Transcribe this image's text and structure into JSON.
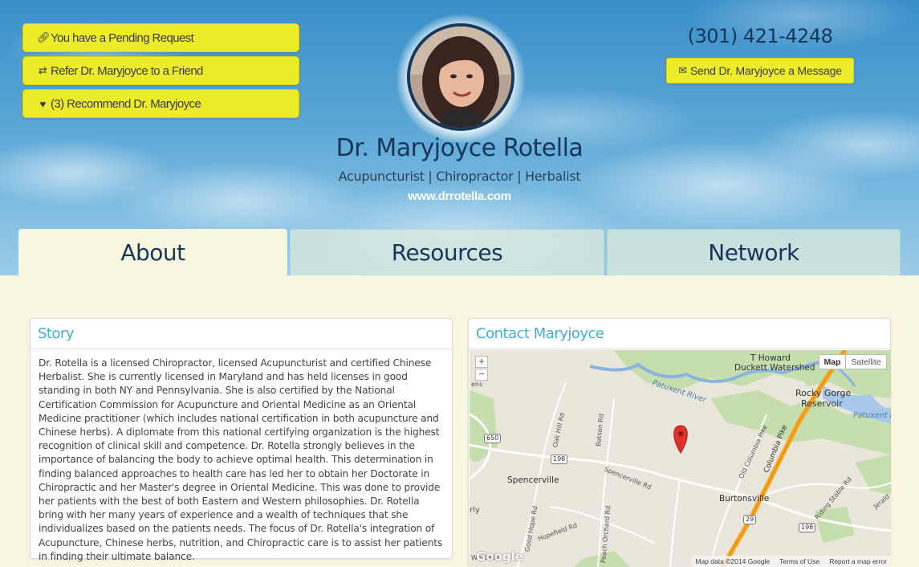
{
  "header": {
    "buttons": {
      "pending": "You have a Pending Request",
      "refer": "Refer Dr. Maryjoyce to a Friend",
      "recommend": "(3) Recommend Dr. Maryjoyce"
    },
    "name": "Dr. Maryjoyce Rotella",
    "specialty": "Acupuncturist | Chiropractor | Herbalist",
    "website": "www.drrotella.com",
    "phone": "(301) 421-4248",
    "message_button": "Send Dr. Maryjoyce a Message"
  },
  "tabs": {
    "about": "About",
    "resources": "Resources",
    "network": "Network"
  },
  "story": {
    "title": "Story",
    "text": "Dr. Rotella is a licensed Chiropractor, licensed Acupuncturist and certified Chinese Herbalist. She is currently licensed in Maryland and has held licenses in good standing in both NY and Pennsylvania. She is also certified by the National Certification Commission for Acupuncture and Oriental Medicine as an Oriental Medicine practitioner (which includes national certification in both acupuncture and Chinese herbs). A diplomate from this national certifying organization is the highest recognition of clinical skill and competence. Dr. Rotella strongly believes in the importance of balancing the body to achieve optimal health. This determination in finding balanced approaches to health care has led her to obtain her Doctorate in Chiropractic and her Master's degree in Oriental Medicine. This was done to provide her patients with the best of both Eastern and Western philosophies. Dr. Rotella bring with her many years of experience and a wealth of techniques that she individualizes based on the patients needs. The focus of Dr. Rotella's integration of Acupuncture, Chinese herbs, nutrition, and Chiropractic care is to assist her patients in finding their ultimate balance."
  },
  "contact": {
    "title": "Contact Maryjoyce",
    "map": {
      "zoom_in": "+",
      "zoom_out": "−",
      "type_map": "Map",
      "type_satellite": "Satellite",
      "labels": {
        "t_howard": "T Howard",
        "duckett": "Duckett Watershed",
        "rocky_gorge": "Rocky Gorge",
        "reservoir": "Reservoir",
        "patuxent_river": "Patuxent River",
        "patuxent_right": "Patuxent R",
        "spencerville": "Spencerville",
        "burtonsville": "Burtonsville",
        "oak_hill": "Oak Hill Rd",
        "batson": "Batson Rd",
        "spencerville_rd": "Spencerville Rd",
        "good_hope": "Good Hope Rd",
        "hopefield": "Hopefield Rd",
        "peach_orchard": "Peach Orchard Rd",
        "old_columbia": "Old Columbia Pike",
        "columbia_pike": "Columbia Pike",
        "riding_stable": "Riding Stable Rd",
        "jerald": "Jerald",
        "ens": "ens",
        "rly": "rly",
        "windmill": "Windmill"
      },
      "shields": [
        "650",
        "198",
        "198",
        "29"
      ],
      "logo": "Google",
      "footer": {
        "data": "Map data ©2014 Google",
        "terms": "Terms of Use",
        "report": "Report a map error"
      }
    }
  },
  "colors": {
    "accent_yellow": "#ecec2a",
    "navy": "#16365a",
    "teal_heading": "#3fb0d8",
    "page_bg": "#f8f6df"
  }
}
